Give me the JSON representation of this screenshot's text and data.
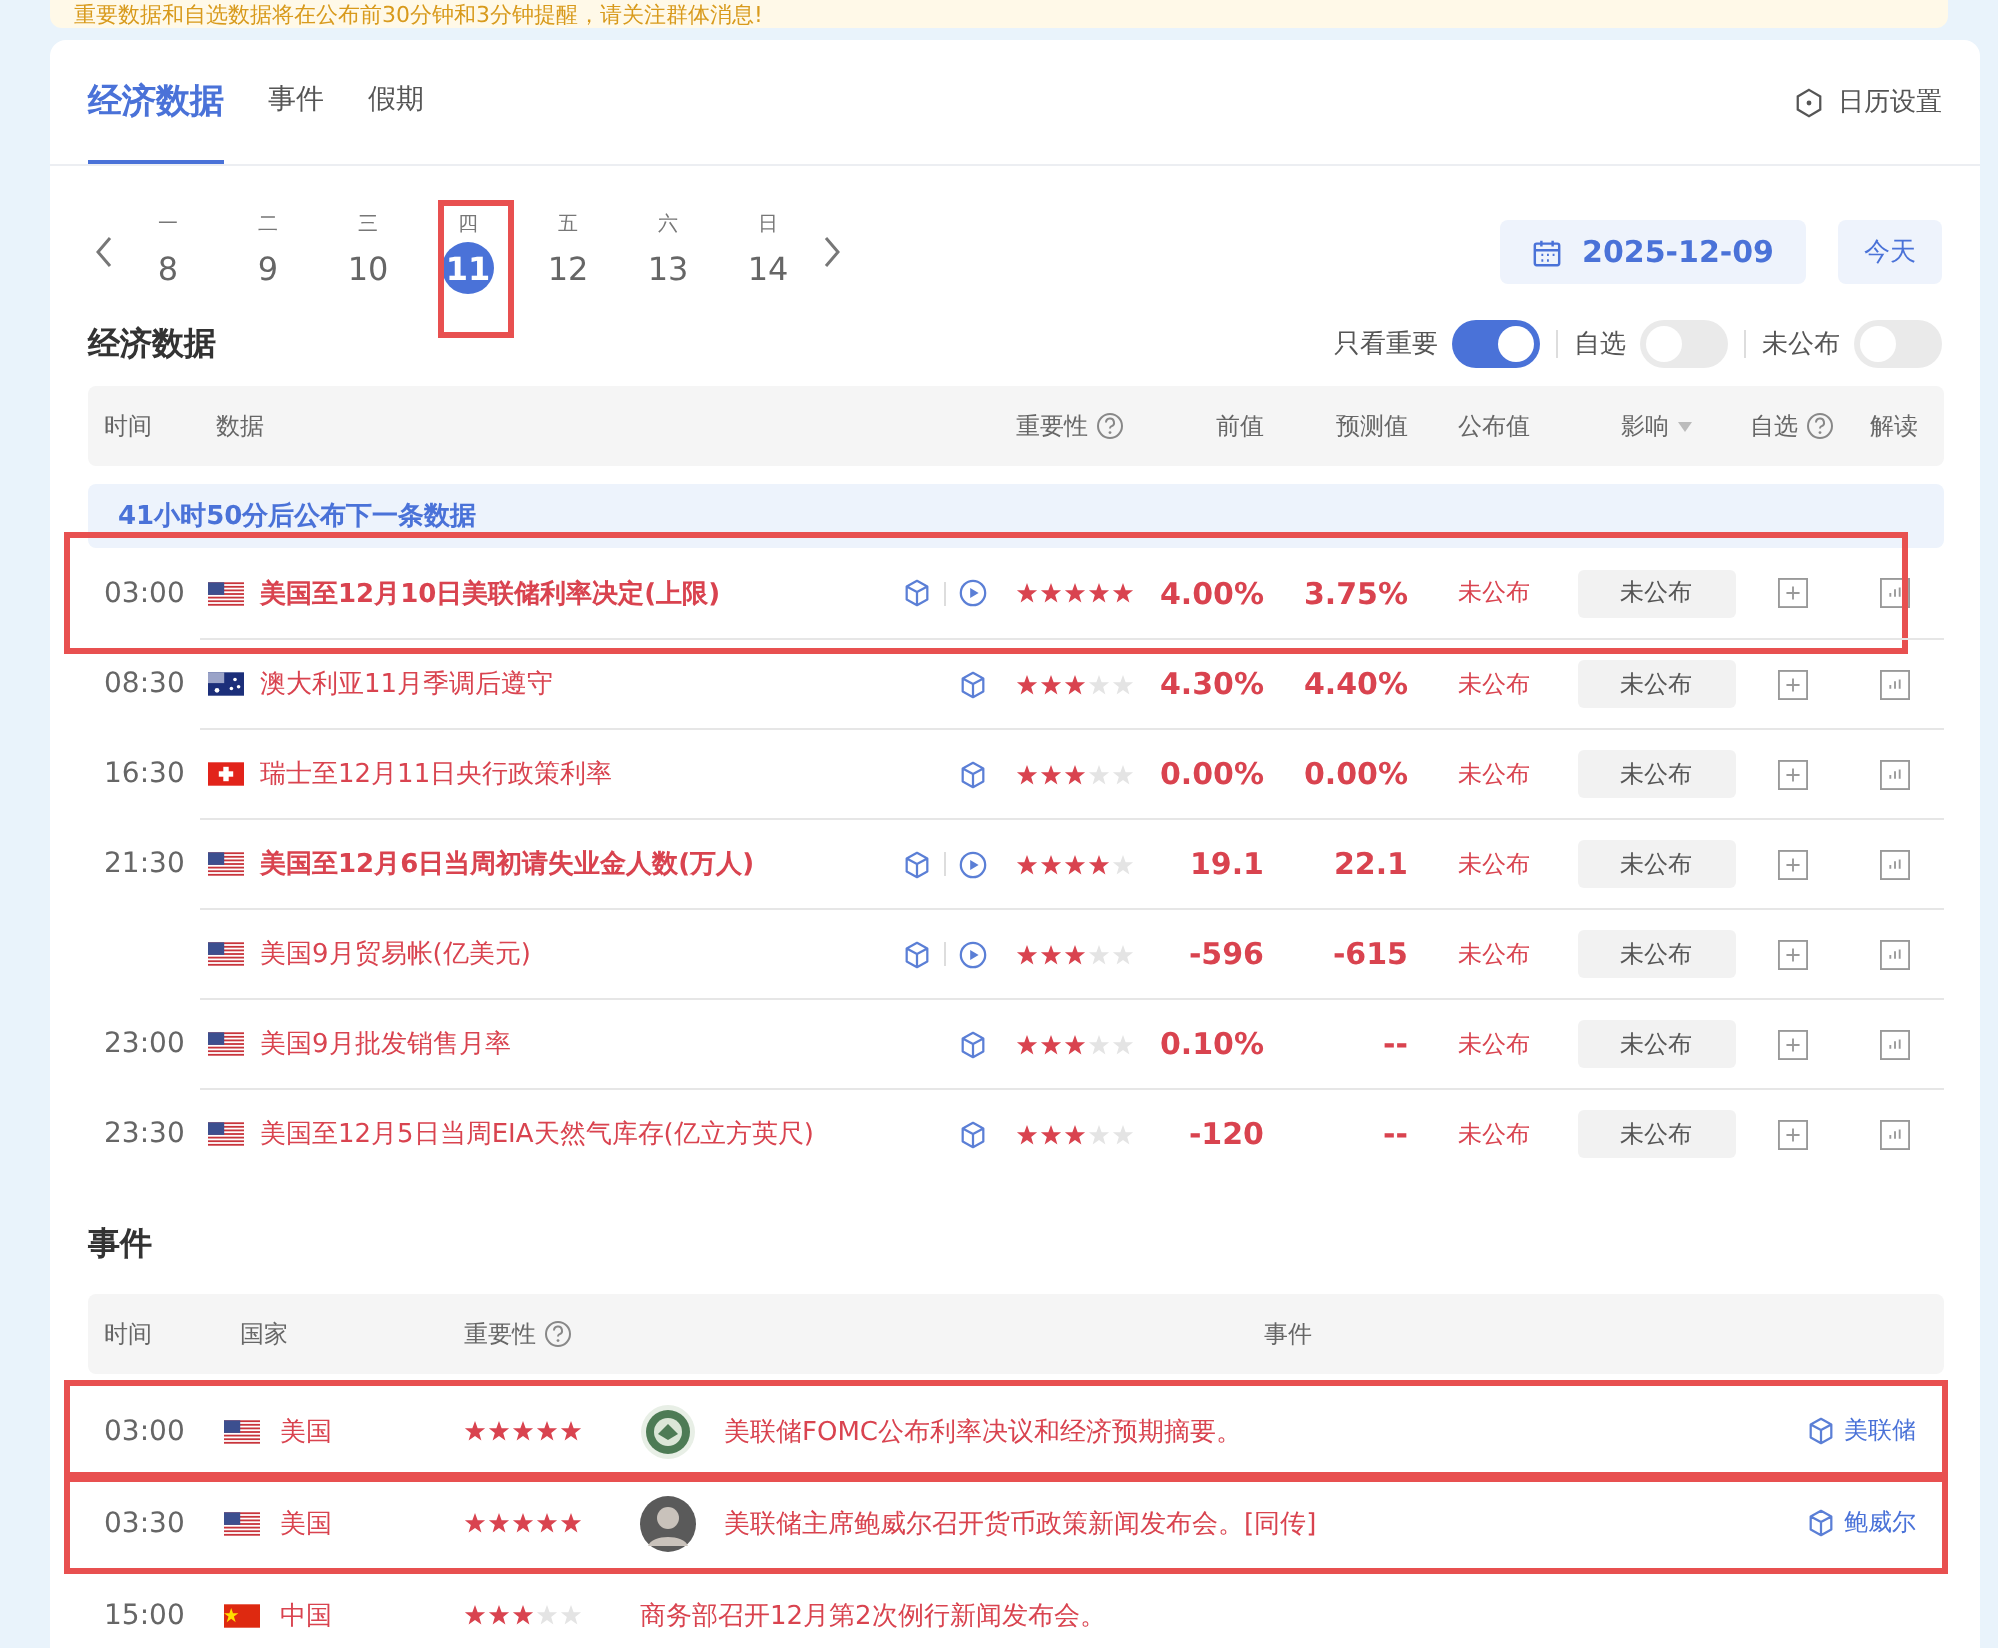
{
  "notice": {
    "text": "重要数据和自选数据将在公布前30分钟和3分钟提醒，请关注群体消息!"
  },
  "tabs": [
    {
      "label": "经济数据",
      "selected": true
    },
    {
      "label": "事件",
      "selected": false
    },
    {
      "label": "假期",
      "selected": false
    }
  ],
  "settings": {
    "label": "日历设置"
  },
  "days": [
    {
      "weekday": "一",
      "day": "8",
      "selected": false,
      "highlighted": false
    },
    {
      "weekday": "二",
      "day": "9",
      "selected": false,
      "highlighted": false
    },
    {
      "weekday": "三",
      "day": "10",
      "selected": false,
      "highlighted": false
    },
    {
      "weekday": "四",
      "day": "11",
      "selected": true,
      "highlighted": true
    },
    {
      "weekday": "五",
      "day": "12",
      "selected": false,
      "highlighted": false
    },
    {
      "weekday": "六",
      "day": "13",
      "selected": false,
      "highlighted": false
    },
    {
      "weekday": "日",
      "day": "14",
      "selected": false,
      "highlighted": false
    }
  ],
  "date_button": "2025-12-09",
  "today_button": "今天",
  "economic": {
    "title": "经济数据",
    "filters": [
      {
        "label": "只看重要",
        "on": true
      },
      {
        "label": "自选",
        "on": false
      },
      {
        "label": "未公布",
        "on": false
      }
    ],
    "columns": [
      "时间",
      "数据",
      "重要性",
      "前值",
      "预测值",
      "公布值",
      "影响",
      "自选",
      "解读"
    ],
    "banner": "41小时50分后公布下一条数据",
    "rows": [
      {
        "time": "03:00",
        "flag": {
          "kind": "us"
        },
        "title": "美国至12月10日美联储利率决定(上限)",
        "bold": true,
        "video": true,
        "stars": 5,
        "previous": "4.00%",
        "forecast": "3.75%",
        "actual": "未公布",
        "impact": "未公布",
        "highlighted": true
      },
      {
        "time": "08:30",
        "flag": {
          "kind": "au"
        },
        "title": "澳大利亚11月季调后遵守",
        "bold": false,
        "video": false,
        "stars": 3,
        "previous": "4.30%",
        "forecast": "4.40%",
        "actual": "未公布",
        "impact": "未公布",
        "highlighted": false
      },
      {
        "time": "16:30",
        "flag": {
          "kind": "ch"
        },
        "title": "瑞士至12月11日央行政策利率",
        "bold": false,
        "video": false,
        "stars": 3,
        "previous": "0.00%",
        "forecast": "0.00%",
        "actual": "未公布",
        "impact": "未公布",
        "highlighted": false
      },
      {
        "time": "21:30",
        "flag": {
          "kind": "us"
        },
        "title": "美国至12月6日当周初请失业金人数(万人)",
        "bold": true,
        "video": true,
        "stars": 4,
        "previous": "19.1",
        "forecast": "22.1",
        "actual": "未公布",
        "impact": "未公布",
        "highlighted": false
      },
      {
        "flag": {
          "kind": "us"
        },
        "title": "美国9月贸易帐(亿美元)",
        "bold": false,
        "video": true,
        "stars": 3,
        "previous": "-596",
        "forecast": "-615",
        "actual": "未公布",
        "impact": "未公布",
        "highlighted": false
      },
      {
        "time": "23:00",
        "flag": {
          "kind": "us"
        },
        "title": "美国9月批发销售月率",
        "bold": false,
        "video": false,
        "stars": 3,
        "previous": "0.10%",
        "forecast": "--",
        "actual": "未公布",
        "impact": "未公布",
        "highlighted": false
      },
      {
        "time": "23:30",
        "flag": {
          "kind": "us"
        },
        "title": "美国至12月5日当周EIA天然气库存(亿立方英尺)",
        "bold": false,
        "video": false,
        "stars": 3,
        "previous": "-120",
        "forecast": "--",
        "actual": "未公布",
        "impact": "未公布",
        "highlighted": false
      }
    ]
  },
  "events": {
    "title": "事件",
    "columns": [
      "时间",
      "国家",
      "重要性",
      "事件"
    ],
    "rows": [
      {
        "time": "03:00",
        "flag": {
          "kind": "us"
        },
        "country": "美国",
        "stars": 5,
        "avatar": {
          "kind": "seal"
        },
        "text": "美联储FOMC公布利率决议和经济预期摘要。",
        "tag": "美联储",
        "highlighted": true
      },
      {
        "time": "03:30",
        "flag": {
          "kind": "us"
        },
        "country": "美国",
        "stars": 5,
        "avatar": {
          "kind": "person"
        },
        "text": "美联储主席鲍威尔召开货币政策新闻发布会。[同传]",
        "tag": "鲍威尔",
        "highlighted": true
      },
      {
        "time": "15:00",
        "flag": {
          "kind": "cn"
        },
        "country": "中国",
        "stars": 3,
        "text": "商务部召开12月第2次例行新闻发布会。",
        "highlighted": false
      }
    ]
  }
}
